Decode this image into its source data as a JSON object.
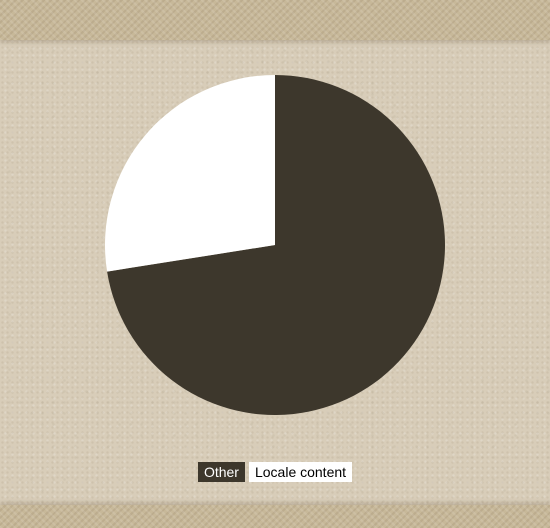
{
  "chart_data": {
    "type": "pie",
    "categories": [
      "Other",
      "Locale content"
    ],
    "values": [
      72.5,
      27.5
    ],
    "colors": [
      "#3d372c",
      "#ffffff"
    ],
    "legend_position": "bottom-center",
    "start_angle": "12 o'clock, clockwise"
  },
  "legend": {
    "items": [
      {
        "label": "Other",
        "color": "#3d372c",
        "text_color": "#ffffff"
      },
      {
        "label": "Locale content",
        "color": "#ffffff",
        "text_color": "#000000"
      }
    ]
  }
}
